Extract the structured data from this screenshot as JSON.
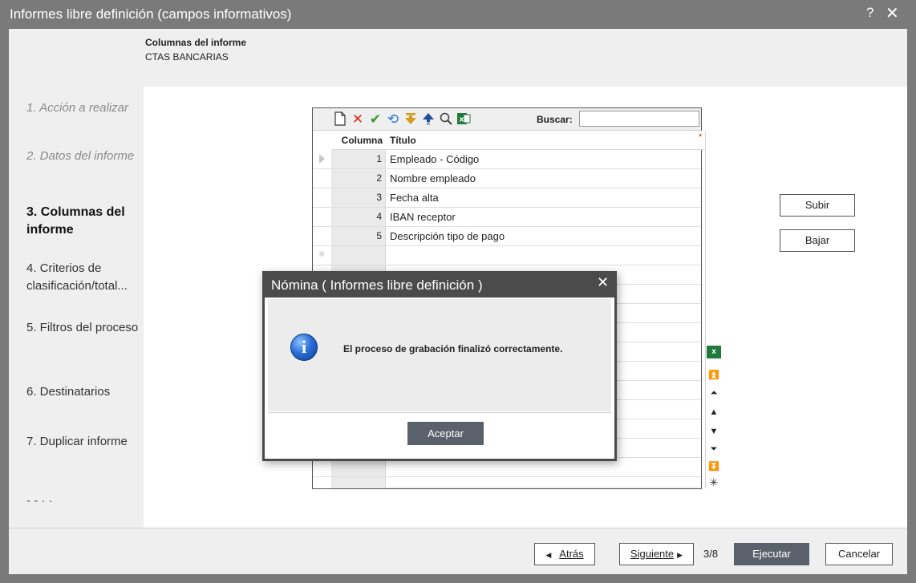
{
  "window": {
    "title": "Informes libre definición (campos informativos)",
    "help_label": "?",
    "close_label": "✕"
  },
  "header": {
    "title": "Columnas del informe",
    "subtitle": "CTAS BANCARIAS"
  },
  "steps": [
    {
      "label": "1. Acción a realizar",
      "state": "past"
    },
    {
      "label": "2. Datos del informe",
      "state": "past"
    },
    {
      "label": "3. Columnas del informe",
      "state": "current"
    },
    {
      "label": "4. Criterios de clasificación/total...",
      "state": "future"
    },
    {
      "label": "5. Filtros del proceso",
      "state": "future"
    },
    {
      "label": "6. Destinatarios",
      "state": "future"
    },
    {
      "label": "7. Duplicar informe",
      "state": "future"
    },
    {
      "label": "- - · ·",
      "state": "future"
    }
  ],
  "toolbar": {
    "search_label": "Buscar:",
    "search_value": "",
    "icons": [
      "new-document-icon",
      "delete-icon",
      "confirm-icon",
      "undo-icon",
      "move-down-icon",
      "move-up-icon",
      "search-icon",
      "excel-icon"
    ]
  },
  "grid": {
    "columns": [
      "Columna",
      "Título"
    ],
    "rows": [
      {
        "num": "1",
        "title": "Empleado -  Código"
      },
      {
        "num": "2",
        "title": "Nombre empleado"
      },
      {
        "num": "3",
        "title": "Fecha alta"
      },
      {
        "num": "4",
        "title": "IBAN receptor"
      },
      {
        "num": "5",
        "title": "Descripción tipo de pago"
      }
    ],
    "new_row_marker": "✳",
    "required_marker": "*"
  },
  "side_buttons": {
    "up": "Subir",
    "down": "Bajar"
  },
  "bottom": {
    "back": "Atrás",
    "next": "Siguiente",
    "page": "3/8",
    "run": "Ejecutar",
    "cancel": "Cancelar"
  },
  "modal": {
    "title": "Nómina ( Informes libre definición )",
    "close_label": "✕",
    "message": "El proceso de grabación finalizó correctamente.",
    "ok_label": "Aceptar"
  },
  "nav": {
    "excel": "x",
    "first": "⏫",
    "page_up": "⏶",
    "up": "▲",
    "down": "▼",
    "page_down": "⏷",
    "last": "⏬",
    "new": "✳"
  }
}
